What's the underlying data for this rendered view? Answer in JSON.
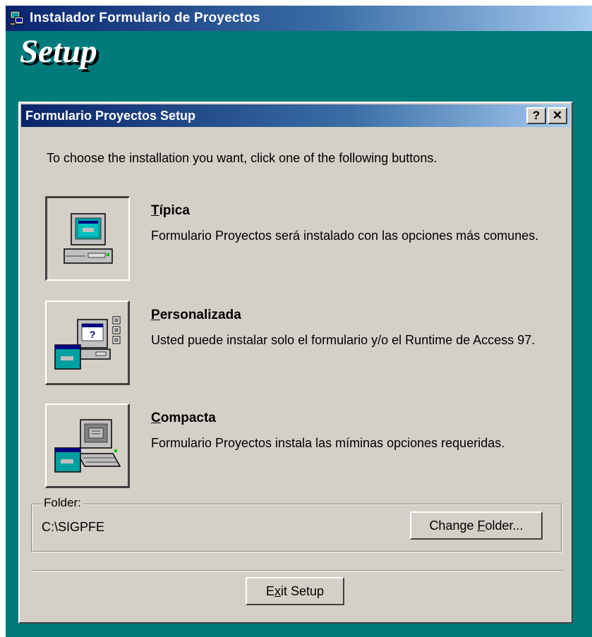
{
  "outer_window": {
    "title": "Instalador Formulario de Proyectos",
    "icon": "installer-icon",
    "background_color": "#007b7b"
  },
  "banner": {
    "text": "Setup"
  },
  "dialog": {
    "title": "Formulario Proyectos Setup",
    "help_button": "?",
    "close_button": "✕",
    "instruction": "To choose the installation you want, click one of the following buttons.",
    "options": [
      {
        "key": "typical",
        "title_accel": "T",
        "title_rest": "ípica",
        "description": "Formulario Proyectos será instalado con las opciones más comunes.",
        "icon": "computer-typical-icon"
      },
      {
        "key": "custom",
        "title_accel": "P",
        "title_rest": "ersonalizada",
        "description": "Usted puede instalar solo el formulario y/o el Runtime de Access 97.",
        "icon": "computer-custom-icon"
      },
      {
        "key": "compact",
        "title_accel": "C",
        "title_rest": "ompacta",
        "description": "Formulario Proyectos instala las míminas opciones requeridas.",
        "icon": "computer-compact-icon"
      }
    ],
    "folder": {
      "label": "Folder:",
      "path": "C:\\SIGPFE",
      "change_button_pre": "Change ",
      "change_button_accel": "F",
      "change_button_post": "older..."
    },
    "exit_button_pre": "E",
    "exit_button_accel": "x",
    "exit_button_post": "it Setup"
  }
}
